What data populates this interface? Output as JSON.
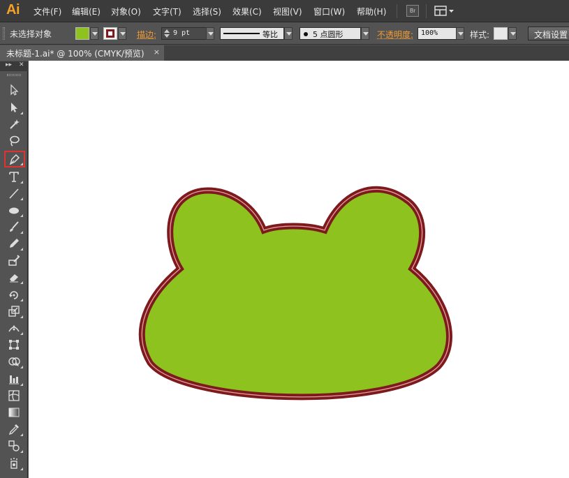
{
  "app": {
    "logo": "Ai"
  },
  "menu": {
    "items": [
      {
        "label": "文件(F)"
      },
      {
        "label": "编辑(E)"
      },
      {
        "label": "对象(O)"
      },
      {
        "label": "文字(T)"
      },
      {
        "label": "选择(S)"
      },
      {
        "label": "效果(C)"
      },
      {
        "label": "视图(V)"
      },
      {
        "label": "窗口(W)"
      },
      {
        "label": "帮助(H)"
      }
    ],
    "bridge_label": "Br"
  },
  "control": {
    "selection_status": "未选择对象",
    "fill_color": "#8dc21f",
    "stroke_label": "描边:",
    "stroke_weight": "9 pt",
    "stroke_profile": "等比",
    "brush_label": "5 点圆形",
    "opacity_label": "不透明度:",
    "opacity_value": "100%",
    "style_label": "样式:",
    "doc_setup": "文档设置"
  },
  "document": {
    "tab_title": "未标题-1.ai* @ 100% (CMYK/预览)",
    "close_glyph": "×"
  },
  "toolbox": {
    "header_glyphs": "▸▸",
    "close_glyph": "✕",
    "selected_tool": "pen-tool",
    "tools": [
      "selection-tool",
      "direct-selection-tool",
      "magic-wand-tool",
      "lasso-tool",
      "pen-tool",
      "type-tool",
      "line-segment-tool",
      "ellipse-tool",
      "paintbrush-tool",
      "pencil-tool",
      "blob-brush-tool",
      "eraser-tool",
      "rotate-tool",
      "scale-tool",
      "width-tool",
      "free-transform-tool",
      "shape-builder-tool",
      "column-graph-tool",
      "mesh-tool",
      "gradient-tool",
      "eyedropper-tool",
      "blend-tool",
      "symbol-sprayer-tool"
    ]
  },
  "artwork": {
    "shape": "frog-head",
    "fill": "#8dc21f",
    "outer_stroke": "#7d1a1e",
    "inner_stroke": "#e9a0a0"
  }
}
